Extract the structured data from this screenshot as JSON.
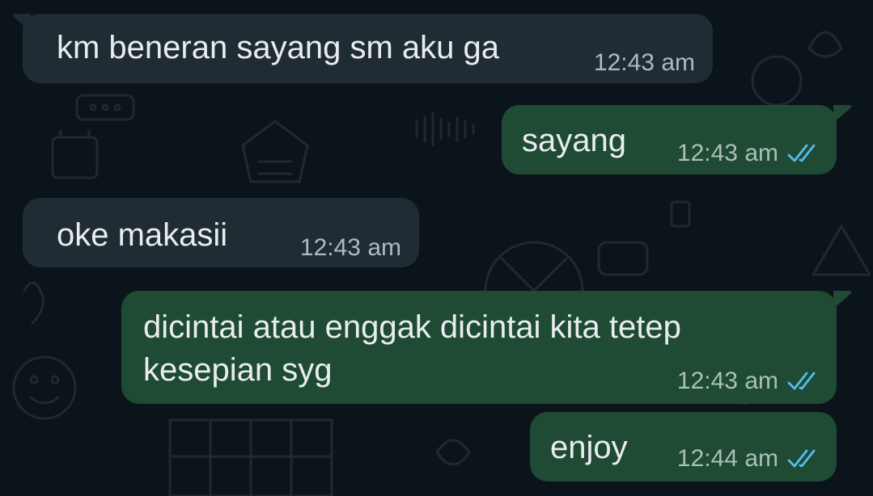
{
  "theme": {
    "background": "#0b141a",
    "incoming_bubble": "#202c33",
    "outgoing_bubble": "#1f4a34",
    "text": "#e9edef",
    "timestamp": "#aebac1",
    "read_tick": "#53bdeb"
  },
  "messages": [
    {
      "direction": "incoming",
      "text": "km beneran sayang sm aku ga",
      "time": "12:43 am",
      "status_icon": ""
    },
    {
      "direction": "outgoing",
      "text": "sayang",
      "time": "12:43 am",
      "status_icon": "double-check-icon"
    },
    {
      "direction": "incoming",
      "text": "oke makasii",
      "time": "12:43 am",
      "status_icon": ""
    },
    {
      "direction": "outgoing",
      "text": "dicintai atau enggak dicintai kita tetep\nkesepian syg",
      "time": "12:43 am",
      "status_icon": "double-check-icon"
    },
    {
      "direction": "outgoing",
      "text": "enjoy",
      "time": "12:44 am",
      "status_icon": "double-check-icon"
    }
  ]
}
